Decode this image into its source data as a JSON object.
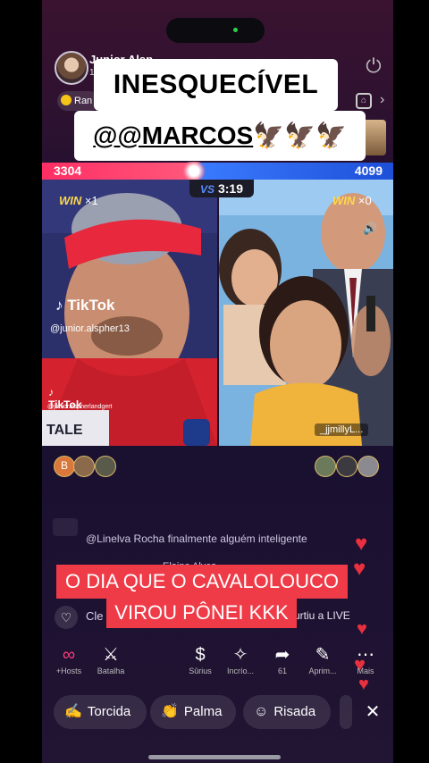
{
  "captions": {
    "title": "INESQUECÍVEL",
    "mention": "@@MARCOS",
    "birds": "🦅🦅🦅",
    "bottom_line1": "O DIA QUE O CAVALOLOUCO",
    "bottom_line2": "VIROU PÔNEI KKK"
  },
  "host": {
    "name": "Junior Alsp",
    "sub": "1",
    "rank_label": "Ran"
  },
  "battle": {
    "score_left": "3304",
    "score_right": "4099",
    "timer": "3:19",
    "vs_label": "VS",
    "win_label": "WIN",
    "win_left_mult": "×1",
    "win_right_mult": "×0",
    "watermark_brand": "TikTok",
    "watermark_user_left": "@junior.alspher13",
    "watermark_brand_small": "TikTok",
    "watermark_user_small": "@junioralspherlandgert",
    "guest_tag": "_jjmillyL...",
    "score_share_left": 0.446
  },
  "supporters": {
    "left_badge": "B"
  },
  "chat": {
    "line1": "@Linelva Rocha finalmente alguém inteligente",
    "line2": "Elaine Alves",
    "line3_user": "Cle",
    "line3_action": "curtiu a LIVE"
  },
  "toolbar": {
    "items": [
      {
        "label": "+Hosts",
        "icon": "link-icon"
      },
      {
        "label": "Batalha",
        "icon": "battle-icon"
      },
      {
        "label": "Sûrius",
        "icon": "dollar-icon"
      },
      {
        "label": "Incrío...",
        "icon": "sparkle-icon"
      },
      {
        "label": "61",
        "icon": "share-icon"
      },
      {
        "label": "Aprim...",
        "icon": "wand-icon"
      },
      {
        "label": "Mais",
        "icon": "more-icon"
      }
    ]
  },
  "bottombar": {
    "torcida": "Torcida",
    "palma": "Palma",
    "risada": "Risada",
    "close": "✕"
  },
  "colors": {
    "left_team": "#ff2e63",
    "right_team": "#3a7bff",
    "caption_red": "#ef3b48"
  }
}
